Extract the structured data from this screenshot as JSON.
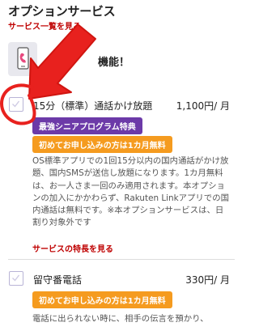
{
  "header": {
    "title": "オプションサービス",
    "list_link": "サービス一覧を見る"
  },
  "feature_banner": {
    "icon": "smartphone-icon",
    "text_visible": "便",
    "text_visible_end": "機能！"
  },
  "services": [
    {
      "name": "15分（標準）通話かけ放題",
      "price": "1,100円/ 月",
      "checked": false,
      "badges": [
        "最強シニアプログラム特典",
        "初めてお申し込みの方は1カ月無料"
      ],
      "description": "OS標準アプリでの1回15分以内の国内通話がかけ放題、国内SMSが送信し放題になります。1カ月無料は、お一人さま一回のみ適用されます。本オプションの加入にかかわらず、Rakuten Linkアプリでの国内通話は無料です。※本オプションサービスは、日割り対象外です",
      "feature_link": "サービスの特長を見る"
    },
    {
      "name": "留守番電話",
      "price": "330円/ 月",
      "checked": false,
      "badges": [
        "初めてお申し込みの方は1カ月無料"
      ],
      "description": "電話に出られない時に、相手の伝言を預かり、"
    }
  ],
  "colors": {
    "brand_red": "#bf0000",
    "badge_purple": "#6c3aa8",
    "badge_orange": "#f59b1f",
    "annotation_red": "#e8211e"
  }
}
